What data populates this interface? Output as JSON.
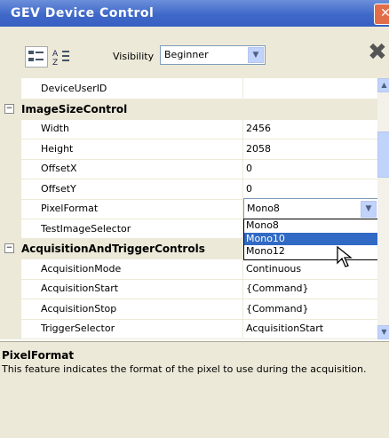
{
  "window": {
    "title": "GEV Device Control",
    "close_glyph": "✕"
  },
  "toolbar": {
    "visibility_label": "Visibility",
    "visibility_value": "Beginner",
    "icons": [
      "categorized-icon",
      "alphabetical-icon",
      "close-x-icon"
    ],
    "x_glyph": "✖"
  },
  "grid": {
    "rows": [
      {
        "type": "prop",
        "name": "DeviceUserID",
        "value": ""
      },
      {
        "type": "category",
        "name": "ImageSizeControl",
        "toggle": "−"
      },
      {
        "type": "prop",
        "name": "Width",
        "value": "2456"
      },
      {
        "type": "prop",
        "name": "Height",
        "value": "2058"
      },
      {
        "type": "prop",
        "name": "OffsetX",
        "value": "0"
      },
      {
        "type": "prop",
        "name": "OffsetY",
        "value": "0"
      },
      {
        "type": "prop",
        "name": "PixelFormat",
        "value": "Mono8"
      },
      {
        "type": "prop",
        "name": "TestImageSelector",
        "value": ""
      },
      {
        "type": "category",
        "name": "AcquisitionAndTriggerControls",
        "toggle": "−"
      },
      {
        "type": "prop",
        "name": "AcquisitionMode",
        "value": "Continuous"
      },
      {
        "type": "prop",
        "name": "AcquisitionStart",
        "value": "{Command}"
      },
      {
        "type": "prop",
        "name": "AcquisitionStop",
        "value": "{Command}"
      },
      {
        "type": "prop",
        "name": "TriggerSelector",
        "value": "AcquisitionStart"
      }
    ],
    "dropdown_options": [
      "Mono8",
      "Mono10",
      "Mono12"
    ],
    "dropdown_selected": "Mono10"
  },
  "description": {
    "title": "PixelFormat",
    "text": "This feature indicates the format of the pixel to use during the acquisition."
  },
  "colors": {
    "titlebar": "#3f68c9",
    "selection": "#316ac5",
    "panel": "#ece9d8"
  }
}
